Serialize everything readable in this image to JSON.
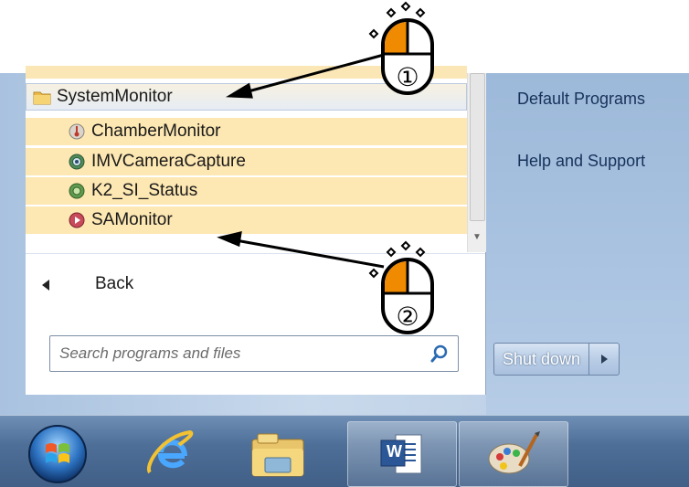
{
  "programs": {
    "folder": "SystemMonitor",
    "items": [
      {
        "label": "ChamberMonitor",
        "icon": "thermometer-icon"
      },
      {
        "label": "IMVCameraCapture",
        "icon": "camera-app-icon"
      },
      {
        "label": "K2_SI_Status",
        "icon": "gear-app-icon"
      },
      {
        "label": "SAMonitor",
        "icon": "play-app-icon"
      }
    ]
  },
  "back": {
    "label": "Back"
  },
  "search": {
    "placeholder": "Search programs and files"
  },
  "right_pane": {
    "items": [
      "Default Programs",
      "Help and Support"
    ],
    "shutdown_label": "Shut down"
  },
  "taskbar": {
    "apps": [
      {
        "name": "start-orb-icon"
      },
      {
        "name": "internet-explorer-icon"
      },
      {
        "name": "file-explorer-icon"
      },
      {
        "name": "word-icon",
        "text": "W"
      },
      {
        "name": "paint-icon"
      }
    ]
  },
  "callouts": [
    {
      "step": "①",
      "target": "SystemMonitor"
    },
    {
      "step": "②",
      "target": "SAMonitor"
    }
  ],
  "colors": {
    "highlight": "#fde9b8",
    "accent": "#f08a00",
    "taskbar": "#4e6f98"
  }
}
